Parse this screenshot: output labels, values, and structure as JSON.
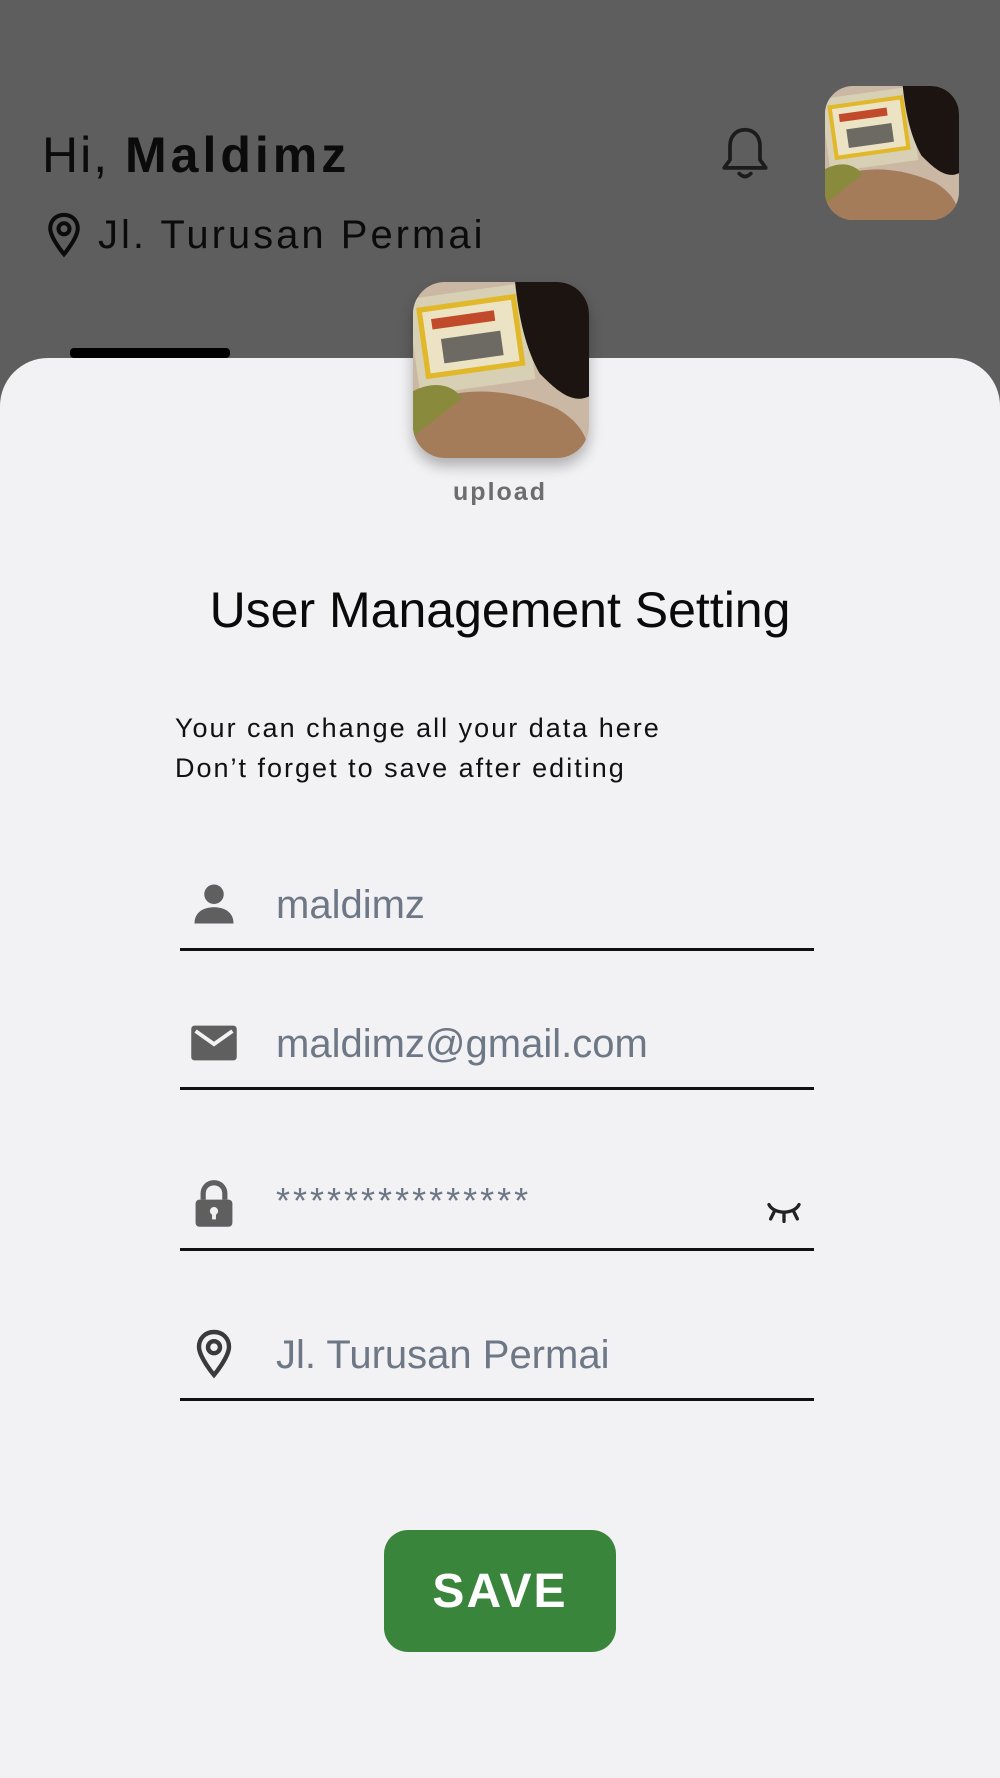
{
  "header": {
    "greeting_prefix": "Hi,",
    "user_name": "Maldimz",
    "location": "Jl. Turusan Permai"
  },
  "profile": {
    "upload_label": "upload"
  },
  "form": {
    "title": "User Management Setting",
    "description_line1": "Your can change all your data here",
    "description_line2": "Don’t forget to save after editing",
    "fields": {
      "username": "maldimz",
      "email": "maldimz@gmail.com",
      "password": "***************",
      "address": "Jl. Turusan Permai"
    },
    "save_label": "SAVE"
  },
  "icons": [
    "location-pin-icon",
    "bell-icon",
    "person-icon",
    "mail-icon",
    "lock-icon",
    "eye-closed-icon"
  ],
  "colors": {
    "overlay_bg": "#5e5e5e",
    "sheet_bg": "#f2f2f4",
    "save_button": "#3a853c",
    "field_text": "#6e7785",
    "icon_gray": "#5f5f5f"
  }
}
